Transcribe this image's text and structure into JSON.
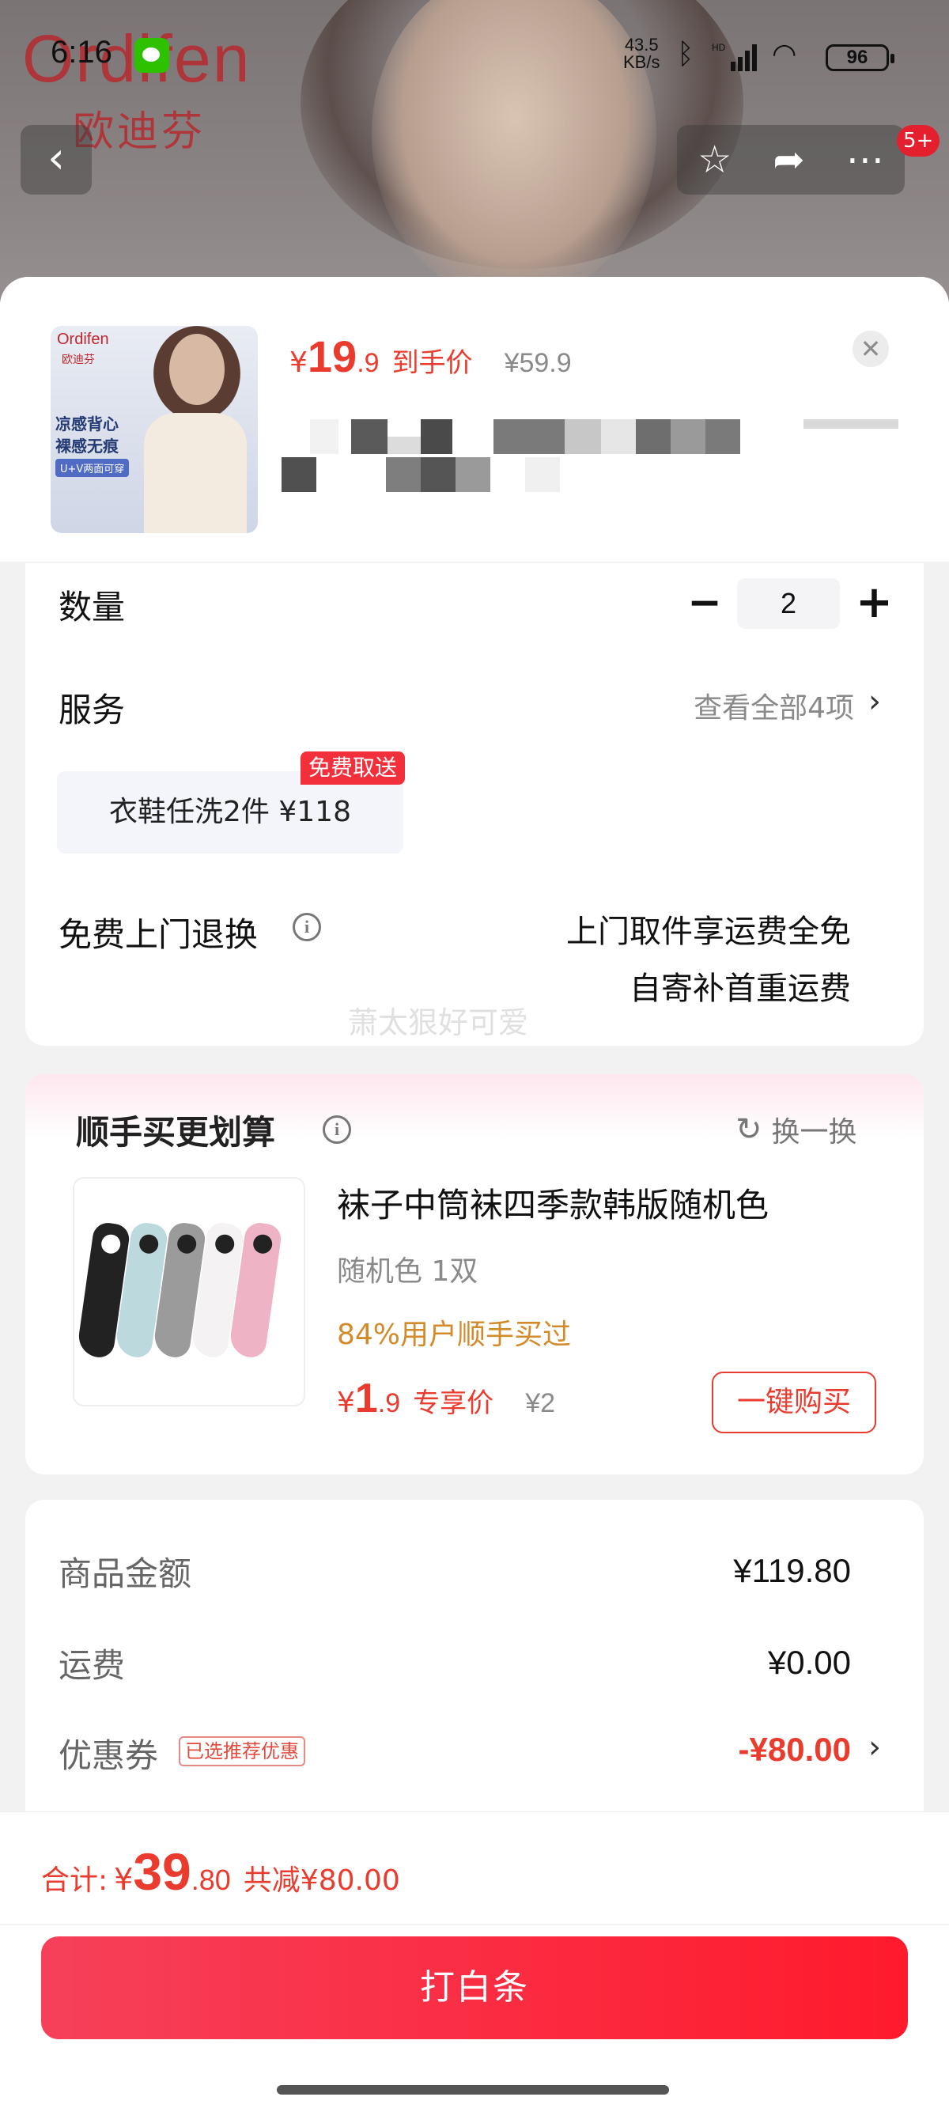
{
  "status_bar": {
    "time": "6:16",
    "net_speed": "43.5",
    "net_unit": "KB/s",
    "network": "HD",
    "battery": "96"
  },
  "background": {
    "brand_logo": "Ordifen",
    "brand_cn": "欧迪芬"
  },
  "nav": {
    "back_icon": "chevron-left",
    "favorite_icon": "star",
    "share_icon": "share",
    "more_icon": "ellipsis",
    "badge": "5+"
  },
  "product": {
    "thumb_brand": "Ordifen",
    "thumb_brand_cn": "欧迪芬",
    "thumb_line1": "凉感背心",
    "thumb_line2": "裸感无痕",
    "thumb_tag": "U+V两面可穿",
    "price_symbol": "¥",
    "price_int": "19",
    "price_dec": ".9",
    "price_tag": "到手价",
    "original_price": "¥59.9",
    "close_icon": "close"
  },
  "options": {
    "quantity_label": "数量",
    "quantity_value": "2",
    "service_label": "服务",
    "service_view_all": "查看全部4项",
    "service_chip": "衣鞋任洗2件  ¥118",
    "service_free_tag": "免费取送",
    "return_label": "免费上门退换",
    "return_desc_line1": "上门取件享运费全免",
    "return_desc_line2": "自寄补首重运费",
    "watermark": "萧太狠好可爱"
  },
  "upsell": {
    "title": "顺手买更划算",
    "refresh_label": "换一换",
    "item_name": "袜子中筒袜四季款韩版随机色",
    "item_spec": "随机色 1双",
    "item_stat": "84%用户顺手买过",
    "price_symbol": "¥",
    "price_int": "1",
    "price_dec": ".9",
    "price_tag": "专享价",
    "original_price": "¥2",
    "buy_label": "一键购买"
  },
  "summary": {
    "goods_label": "商品金额",
    "goods_value": "¥119.80",
    "shipping_label": "运费",
    "shipping_value": "¥0.00",
    "coupon_label": "优惠券",
    "coupon_tag": "已选推荐优惠",
    "coupon_value": "-¥80.00"
  },
  "footer": {
    "total_label": "合计:",
    "total_symbol": "¥",
    "total_int": "39",
    "total_dec": ".80",
    "total_saved": "共减¥80.00",
    "pay_label": "打白条"
  },
  "colors": {
    "accent_red": "#e93b2e",
    "pay_button": "#ff1a2c",
    "upsell_stat": "#d38a2a"
  }
}
